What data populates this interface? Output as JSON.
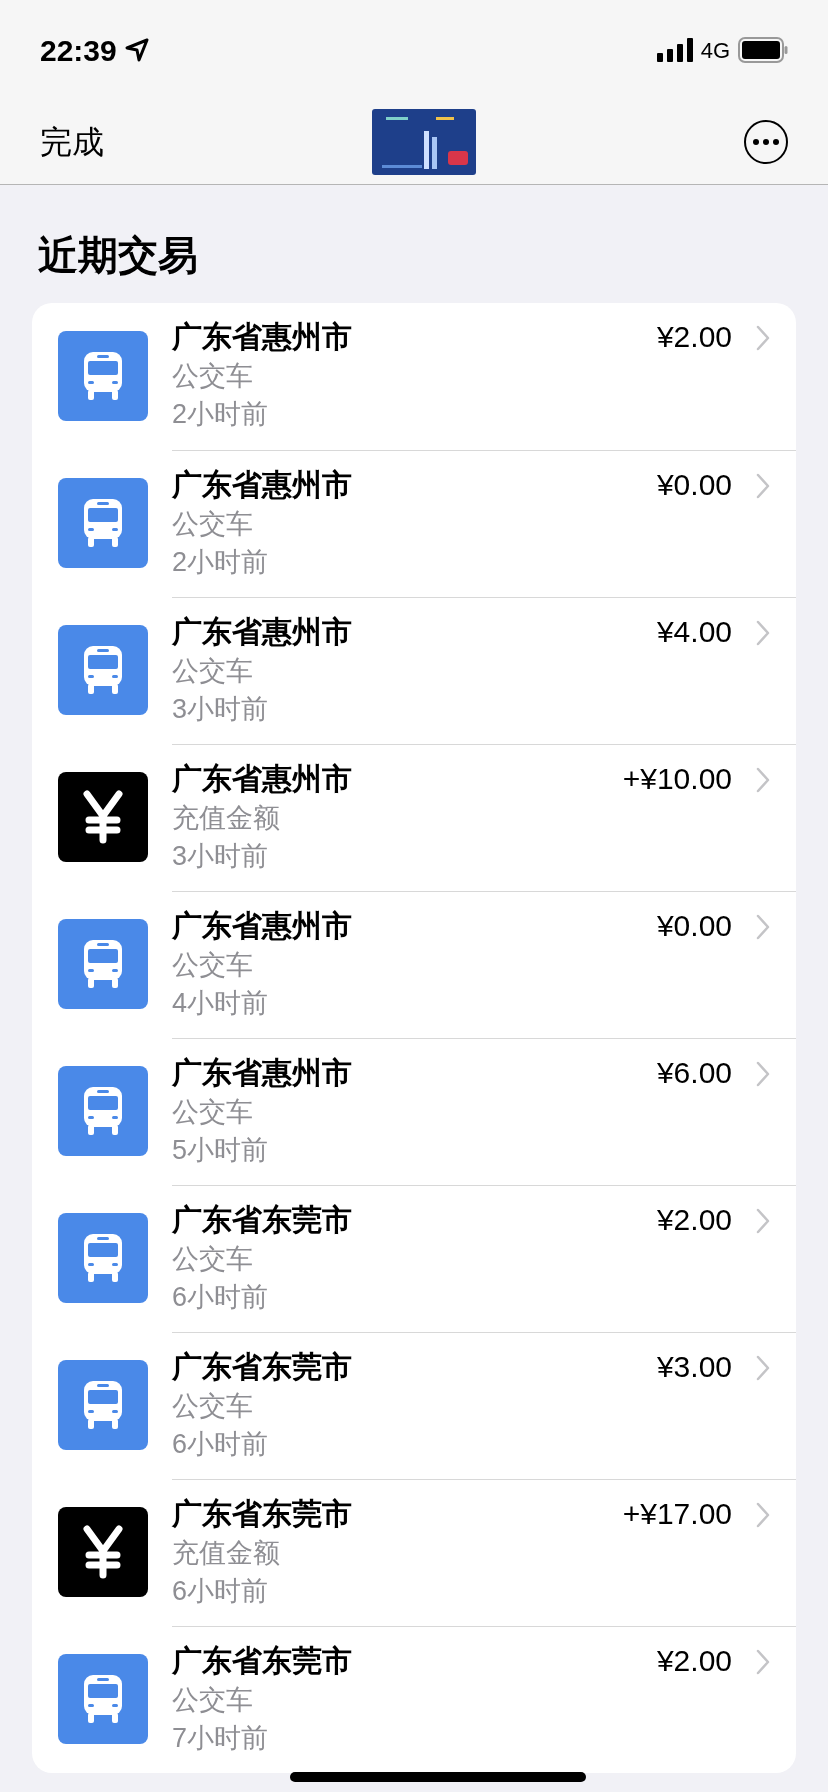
{
  "status_bar": {
    "time": "22:39",
    "network": "4G"
  },
  "nav": {
    "done": "完成"
  },
  "section_title": "近期交易",
  "transactions": [
    {
      "kind": "bus",
      "place": "广东省惠州市",
      "type": "公交车",
      "time": "2小时前",
      "amount": "¥2.00"
    },
    {
      "kind": "bus",
      "place": "广东省惠州市",
      "type": "公交车",
      "time": "2小时前",
      "amount": "¥0.00"
    },
    {
      "kind": "bus",
      "place": "广东省惠州市",
      "type": "公交车",
      "time": "3小时前",
      "amount": "¥4.00"
    },
    {
      "kind": "topup",
      "place": "广东省惠州市",
      "type": "充值金额",
      "time": "3小时前",
      "amount": "+¥10.00"
    },
    {
      "kind": "bus",
      "place": "广东省惠州市",
      "type": "公交车",
      "time": "4小时前",
      "amount": "¥0.00"
    },
    {
      "kind": "bus",
      "place": "广东省惠州市",
      "type": "公交车",
      "time": "5小时前",
      "amount": "¥6.00"
    },
    {
      "kind": "bus",
      "place": "广东省东莞市",
      "type": "公交车",
      "time": "6小时前",
      "amount": "¥2.00"
    },
    {
      "kind": "bus",
      "place": "广东省东莞市",
      "type": "公交车",
      "time": "6小时前",
      "amount": "¥3.00"
    },
    {
      "kind": "topup",
      "place": "广东省东莞市",
      "type": "充值金额",
      "time": "6小时前",
      "amount": "+¥17.00"
    },
    {
      "kind": "bus",
      "place": "广东省东莞市",
      "type": "公交车",
      "time": "7小时前",
      "amount": "¥2.00"
    }
  ]
}
